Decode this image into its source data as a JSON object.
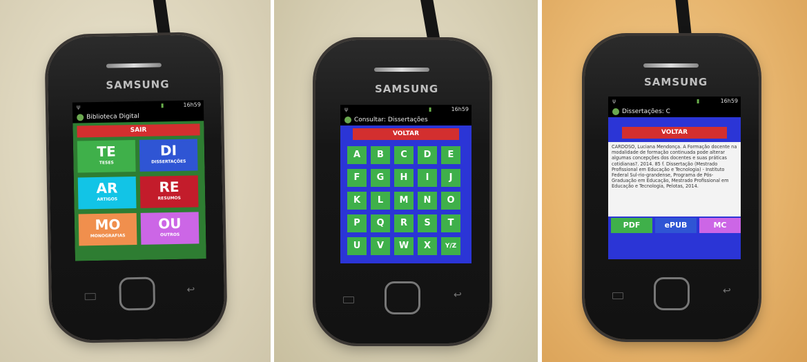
{
  "phone_brand": "SAMSUNG",
  "status": {
    "time": "16h59",
    "usb_icon": "usb-icon",
    "signal_icon": "signal-icon"
  },
  "screen1": {
    "title": "Biblioteca Digital",
    "exit_button": "SAIR",
    "tiles": [
      {
        "code": "TE",
        "label": "TESES",
        "color": "#3fb04a"
      },
      {
        "code": "DI",
        "label": "DISSERTAÇÕES",
        "color": "#2f55d4"
      },
      {
        "code": "AR",
        "label": "ARTIGOS",
        "color": "#12c4e6"
      },
      {
        "code": "RE",
        "label": "RESUMOS",
        "color": "#c31c2b"
      },
      {
        "code": "MO",
        "label": "MONOGRAFIAS",
        "color": "#f08f4d"
      },
      {
        "code": "OU",
        "label": "OUTROS",
        "color": "#cc66e6"
      }
    ]
  },
  "screen2": {
    "title": "Consultar: Dissertações",
    "back_button": "VOLTAR",
    "letters": [
      "A",
      "B",
      "C",
      "D",
      "E",
      "F",
      "G",
      "H",
      "I",
      "J",
      "K",
      "L",
      "M",
      "N",
      "O",
      "P",
      "Q",
      "R",
      "S",
      "T",
      "U",
      "V",
      "W",
      "X",
      "Y/Z"
    ]
  },
  "screen3": {
    "title": "Dissertações: C",
    "back_button": "VOLTAR",
    "citation": "CARDOSO, Luciana Mendonça. A Formação docente na modalidade de formação continuada pode alterar algumas concepções dos docentes e suas práticas cotidianas?. 2014. 85 f. Dissertação (Mestrado Profissional em Educação e Tecnologia) - Instituto Federal Sul-rio-grandense, Programa de Pós-Graduação em Educação, Mestrado Profissional em Educação e Tecnologia, Pelotas, 2014.",
    "format_buttons": [
      {
        "label": "PDF",
        "color": "#3fb04a"
      },
      {
        "label": "ePUB",
        "color": "#2f55d4"
      },
      {
        "label": "MC",
        "color": "#cc66e6"
      }
    ]
  }
}
